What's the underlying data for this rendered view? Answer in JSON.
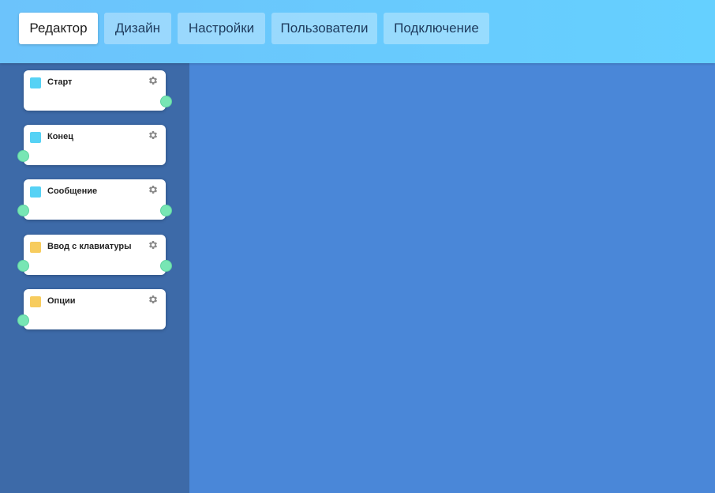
{
  "tabs": [
    {
      "label": "Редактор",
      "active": true
    },
    {
      "label": "Дизайн",
      "active": false
    },
    {
      "label": "Настройки",
      "active": false
    },
    {
      "label": "Пользователи",
      "active": false
    },
    {
      "label": "Подключение",
      "active": false
    }
  ],
  "palette": {
    "nodes": [
      {
        "label": "Старт",
        "color": "#56d2f5",
        "icon": "gear-icon",
        "ports": [
          "output"
        ]
      },
      {
        "label": "Конец",
        "color": "#56d2f5",
        "icon": "gear-icon",
        "ports": [
          "input"
        ]
      },
      {
        "label": "Сообщение",
        "color": "#56d2f5",
        "icon": "gear-icon",
        "ports": [
          "input",
          "output"
        ]
      },
      {
        "label": "Ввод с клавиатуры",
        "color": "#f7cc5e",
        "icon": "gear-icon",
        "ports": [
          "input",
          "output"
        ]
      },
      {
        "label": "Опции",
        "color": "#f7cc5e",
        "icon": "gear-icon",
        "ports": [
          "input"
        ]
      }
    ]
  },
  "colors": {
    "topbar": "#6cc3fb",
    "sidebar": "#3d6aa8",
    "canvas": "#4a87d8",
    "port": "#78e6b4"
  }
}
